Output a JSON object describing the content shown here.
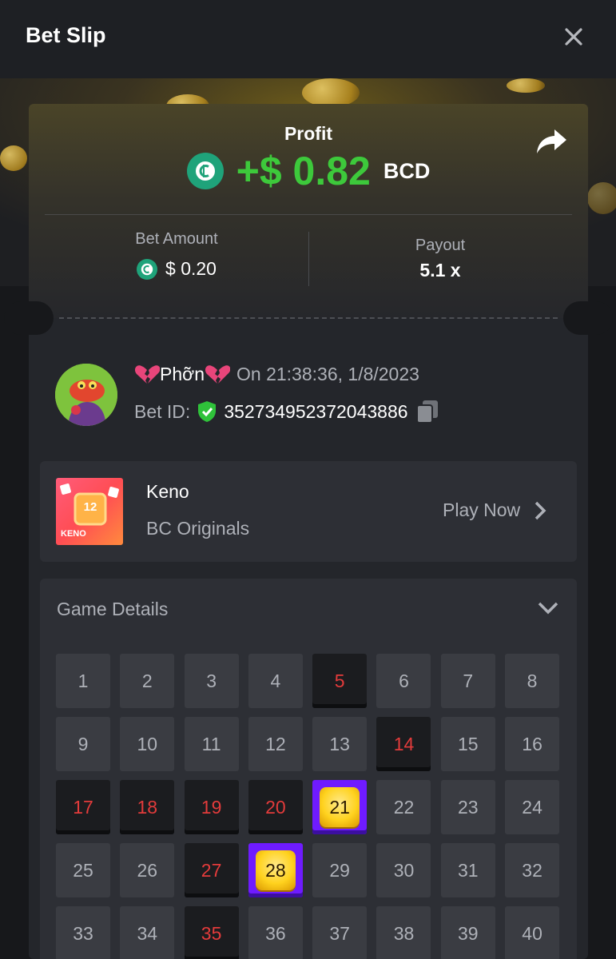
{
  "header": {
    "title": "Bet Slip"
  },
  "profit": {
    "label": "Profit",
    "value": "+$ 0.82",
    "currency": "BCD"
  },
  "bet": {
    "amount_label": "Bet Amount",
    "amount": "$ 0.20",
    "payout_label": "Payout",
    "payout": "5.1 x"
  },
  "user": {
    "name": "Phỡn",
    "time": "On 21:38:36, 1/8/2023",
    "bet_id_label": "Bet ID:",
    "bet_id": "352734952372043886"
  },
  "game": {
    "name": "Keno",
    "provider": "BC Originals",
    "play_label": "Play Now",
    "thumb_number": "12",
    "thumb_label": "KENO"
  },
  "details": {
    "title": "Game Details"
  },
  "keno": {
    "numbers": [
      1,
      2,
      3,
      4,
      5,
      6,
      7,
      8,
      9,
      10,
      11,
      12,
      13,
      14,
      15,
      16,
      17,
      18,
      19,
      20,
      21,
      22,
      23,
      24,
      25,
      26,
      27,
      28,
      29,
      30,
      31,
      32,
      33,
      34,
      35,
      36,
      37,
      38,
      39,
      40
    ],
    "misses": [
      5,
      14,
      17,
      18,
      19,
      20,
      27,
      35
    ],
    "hits": [
      21,
      28
    ]
  },
  "colors": {
    "profit_green": "#3dc93b",
    "miss_red": "#e33b3b",
    "hit_purple": "#6f1bff",
    "hit_gold": "#ffd21e",
    "bcd_teal": "#1fa37a"
  }
}
